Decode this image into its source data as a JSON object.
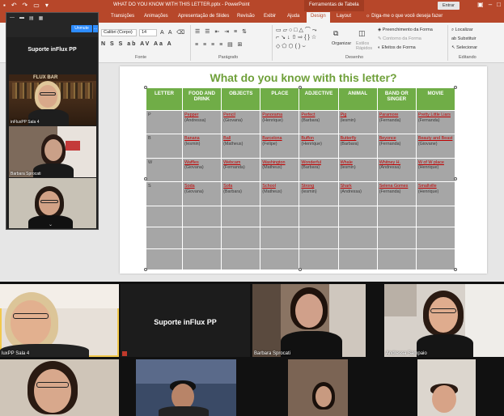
{
  "app": {
    "doc_title": "WHAT DO YOU KNOW WITH THIS LETTER.pptx - PowerPoint",
    "context_title": "Ferramentas de Tabela",
    "signin_label": "Entrar",
    "tell_me": "Diga-me o que você deseja fazer"
  },
  "tabs": [
    "Transições",
    "Animações",
    "Apresentação de Slides",
    "Revisão",
    "Exibir",
    "Ajuda",
    "Design",
    "Layout"
  ],
  "ribbon": {
    "font_name": "Calibri (Corpo)",
    "font_size": "14",
    "group_font": "Fonte",
    "group_paragraph": "Parágrafo",
    "group_drawing": "Desenho",
    "group_editing": "Editando",
    "organize": "Organizar",
    "quick_styles": "Estilos Rápidos",
    "shape_fill": "Preenchimento da Forma",
    "shape_outline": "Contorno da Forma",
    "shape_effects": "Efeitos de Forma",
    "find": "Localizar",
    "replace": "Substituir",
    "select": "Selecionar"
  },
  "slide": {
    "title": "What do you know with this letter?",
    "headers": [
      "LETTER",
      "FOOD AND DRINK",
      "OBJECTS",
      "PLACE",
      "ADJECTIVE",
      "ANIMAL",
      "BAND OR SINGER",
      "MOVIE"
    ],
    "rows": [
      {
        "letter": "P",
        "cells": [
          {
            "word": "Pepper",
            "person": "(Andressa)"
          },
          {
            "word": "Pencil",
            "person": "(Giovana)"
          },
          {
            "word": "Panorama",
            "person": "(Henrique)"
          },
          {
            "word": "Perfect",
            "person": "(Barbara)"
          },
          {
            "word": "Pig",
            "person": "(lesmin)"
          },
          {
            "word": "Paramore",
            "person": "(Fernanda)"
          },
          {
            "word": "Pretty Little Liars",
            "person": "(Fernanda)"
          }
        ]
      },
      {
        "letter": "B",
        "cells": [
          {
            "word": "Banana",
            "person": "(Iesmin)"
          },
          {
            "word": "Ball",
            "person": "(Matheus)"
          },
          {
            "word": "Barcelona",
            "person": "(Felipe)"
          },
          {
            "word": "Buffon",
            "person": "(Henrique)"
          },
          {
            "word": "Butterfly",
            "person": "(Barbara)"
          },
          {
            "word": "Beyonce",
            "person": "(Fernanda)"
          },
          {
            "word": "Beauty and Beast",
            "person": "(Giovane)"
          }
        ]
      },
      {
        "letter": "W",
        "cells": [
          {
            "word": "Waffles",
            "person": "(Giovana)"
          },
          {
            "word": "Webcam",
            "person": "(Fernanda)"
          },
          {
            "word": "Washington",
            "person": "(Matheus)"
          },
          {
            "word": "Wonderful",
            "person": "(Barbara)"
          },
          {
            "word": "Whale",
            "person": "(lesmin)"
          },
          {
            "word": "Whitney H.",
            "person": "(Andressa)"
          },
          {
            "word": "W of W place",
            "person": "(Henrique)"
          }
        ]
      },
      {
        "letter": "S",
        "cells": [
          {
            "word": "Soda",
            "person": "(Giovana)"
          },
          {
            "word": "Sofa",
            "person": "(Barbara)"
          },
          {
            "word": "School",
            "person": "(Matheus)"
          },
          {
            "word": "Strong",
            "person": "(lesmin)"
          },
          {
            "word": "Shark",
            "person": "(Andressa)"
          },
          {
            "word": "Selena Gomes",
            "person": "(Fernanda)"
          },
          {
            "word": "Smallville",
            "person": "(Henrique)"
          }
        ]
      }
    ]
  },
  "zoom_panel": {
    "meeting_name": "Suporte inFlux PP",
    "unmute_label": "Unmute",
    "more_label": "...",
    "participants": [
      "inFluxPP Sala 4",
      "Barbara Sprocati",
      ""
    ]
  },
  "gallery": {
    "support_name": "Suporte inFlux PP",
    "labels": [
      "luxPP Sala 4",
      "Barbara Sprocati",
      "Andressa Sampaio"
    ]
  }
}
